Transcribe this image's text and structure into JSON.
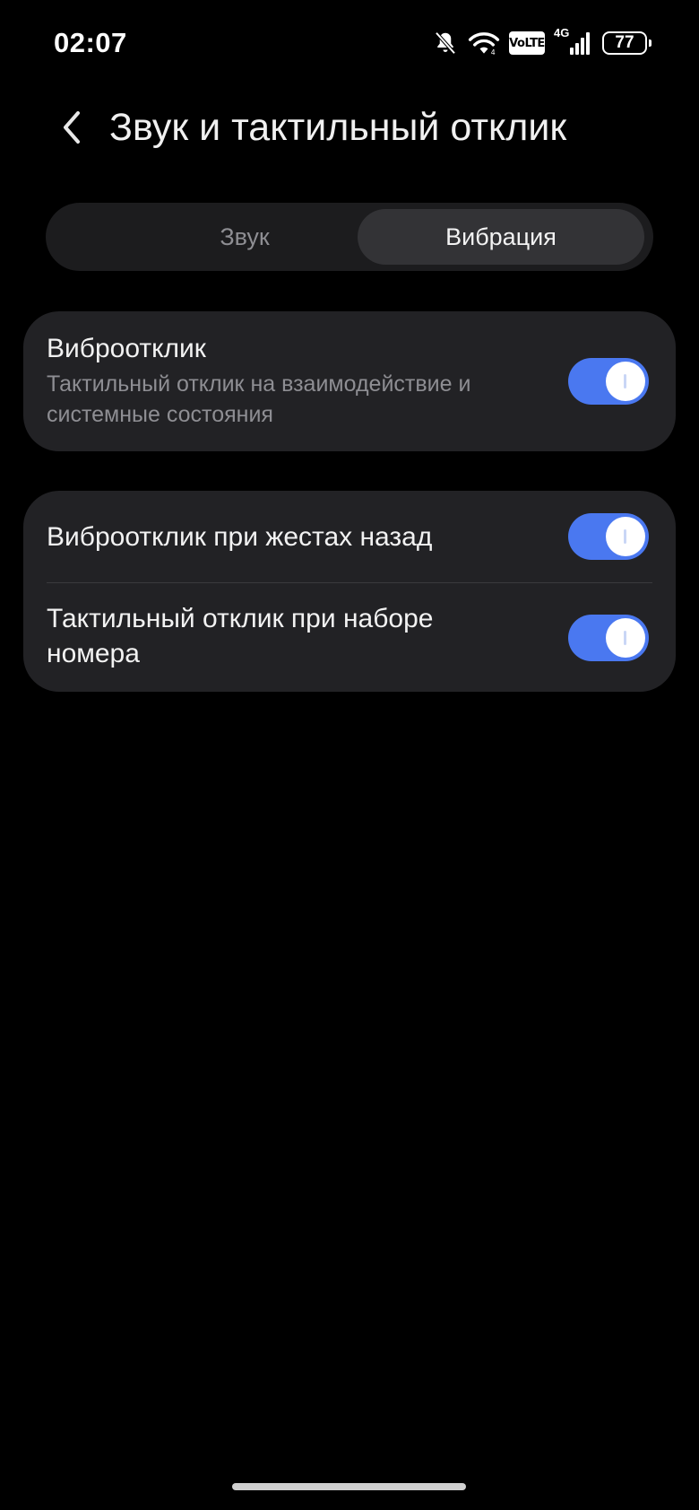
{
  "status_bar": {
    "time": "02:07",
    "volte": "VoLTE",
    "network": "4G",
    "battery": "77",
    "icons": [
      "bell-muted-icon",
      "wifi-icon",
      "volte-icon",
      "signal-icon",
      "battery-icon"
    ]
  },
  "header": {
    "title": "Звук и тактильный отклик",
    "back_icon": "chevron-left-icon"
  },
  "tabs": [
    {
      "label": "Звук",
      "selected": false
    },
    {
      "label": "Вибрация",
      "selected": true
    }
  ],
  "cards": [
    {
      "rows": [
        {
          "title": "Виброотклик",
          "subtitle": "Тактильный отклик на взаимодействие и системные состояния",
          "toggle_on": true
        }
      ]
    },
    {
      "rows": [
        {
          "title": "Виброотклик при жестах назад",
          "toggle_on": true
        },
        {
          "title": "Тактильный отклик при наборе номера",
          "toggle_on": true
        }
      ]
    }
  ],
  "colors": {
    "background": "#000000",
    "card": "#222225",
    "toggle_on": "#4a78f0",
    "secondary_text": "#8e8e93"
  }
}
